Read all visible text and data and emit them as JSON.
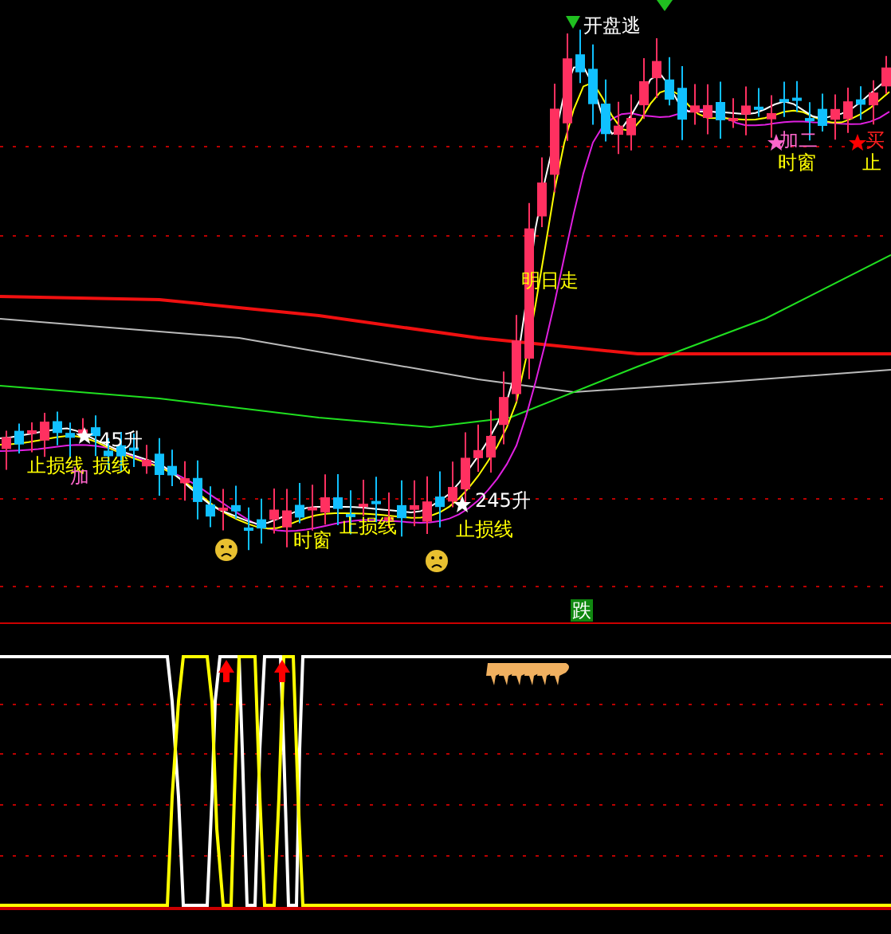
{
  "main_chart": {
    "labels": [
      {
        "text": "开盘逃",
        "color": "#ffffff"
      },
      {
        "text": "加二",
        "color": "#ff66cc"
      },
      {
        "text": "时窗",
        "color": "#ffff00"
      },
      {
        "text": "买",
        "color": "#ff2020"
      },
      {
        "text": "止",
        "color": "#ffff00"
      },
      {
        "text": "明日走",
        "color": "#ffff00"
      },
      {
        "text": "45升",
        "color": "#ffffff"
      },
      {
        "text": "止损线",
        "color": "#ffff00"
      },
      {
        "text": "损线",
        "color": "#ffff00"
      },
      {
        "text": "加",
        "color": "#ff66cc"
      },
      {
        "text": "时窗",
        "color": "#ffff00"
      },
      {
        "text": "止损线",
        "color": "#ffff00"
      },
      {
        "text": "245升",
        "color": "#ffffff"
      },
      {
        "text": "止损线",
        "color": "#ffff00"
      }
    ]
  },
  "signal_badge": {
    "text": "跌"
  }
}
